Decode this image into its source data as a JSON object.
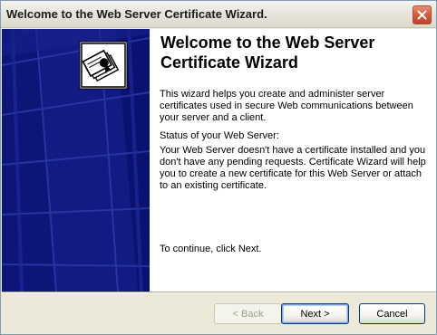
{
  "window": {
    "title": "Welcome to the Web Server Certificate Wizard."
  },
  "icons": {
    "close": "close-icon",
    "wizard": "certificate-icon"
  },
  "content": {
    "heading_line1": "Welcome to the Web Server",
    "heading_line2": "Certificate Wizard",
    "intro": "This wizard helps you create and administer server certificates used in secure Web communications between your server and a client.",
    "status_label": "Status of your Web Server:",
    "status_text": "Your Web Server doesn't have a certificate installed and you don't have any pending requests. Certificate Wizard will help you to create a new certificate for this Web Server or attach to an existing certificate.",
    "continue_text": "To continue, click Next."
  },
  "buttons": {
    "back": "< Back",
    "next": "Next >",
    "cancel": "Cancel"
  },
  "colors": {
    "banner": "#0b1170",
    "banner_stripe": "#2a3aa8",
    "close": "#d35a3d"
  }
}
